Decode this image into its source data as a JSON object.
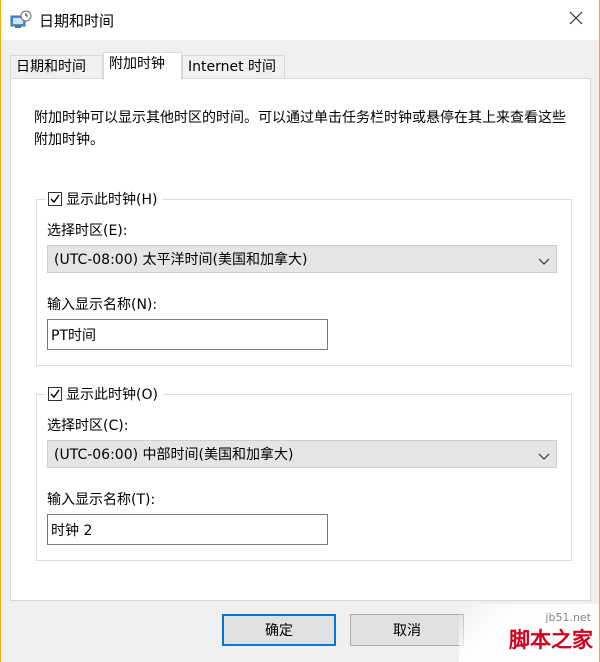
{
  "window": {
    "title": "日期和时间",
    "icon": "date-time-icon",
    "close_icon": "close-icon"
  },
  "tabs": [
    {
      "label": "日期和时间",
      "active": false
    },
    {
      "label": "附加时钟",
      "active": true
    },
    {
      "label": "Internet 时间",
      "active": false
    }
  ],
  "description": "附加时钟可以显示其他时区的时间。可以通过单击任务栏时钟或悬停在其上来查看这些附加时钟。",
  "clock1": {
    "checkbox_label": "显示此时钟(H)",
    "checked": true,
    "timezone_label": "选择时区(E):",
    "timezone_value": "(UTC-08:00) 太平洋时间(美国和加拿大)",
    "name_label": "输入显示名称(N):",
    "name_value": "PT时间"
  },
  "clock2": {
    "checkbox_label": "显示此时钟(O)",
    "checked": true,
    "timezone_label": "选择时区(C):",
    "timezone_value": "(UTC-06:00) 中部时间(美国和加拿大)",
    "name_label": "输入显示名称(T):",
    "name_value": "时钟 2"
  },
  "buttons": {
    "ok": "确定",
    "cancel": "取消"
  },
  "watermark": {
    "url": "jb51.net",
    "text": "脚本之家"
  },
  "colors": {
    "window_border": "#f2b400",
    "primary_button_border": "#0078d7",
    "watermark_red": "#d2001e"
  }
}
